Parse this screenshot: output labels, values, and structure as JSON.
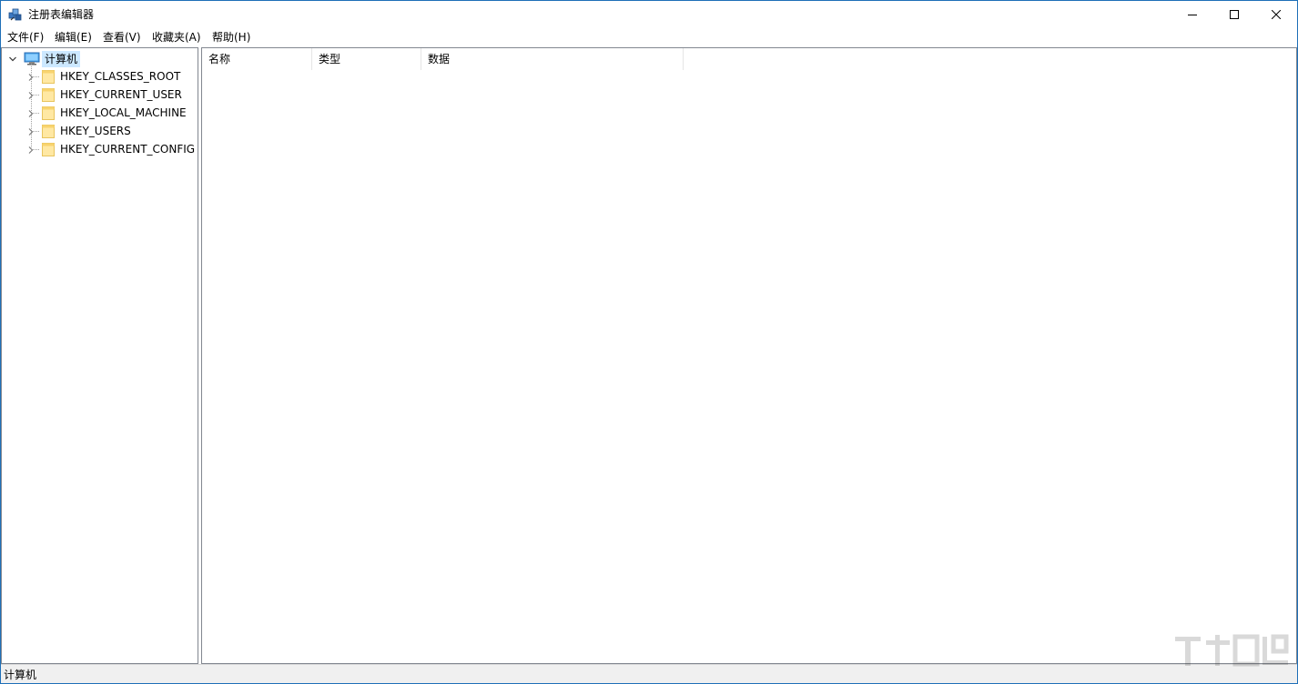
{
  "window": {
    "title": "注册表编辑器",
    "accent": "#1e6fb8"
  },
  "menu": [
    "文件(F)",
    "编辑(E)",
    "查看(V)",
    "收藏夹(A)",
    "帮助(H)"
  ],
  "tree": {
    "root": {
      "label": "计算机",
      "icon": "computer-icon",
      "expanded": true,
      "selected": true
    },
    "children": [
      {
        "label": "HKEY_CLASSES_ROOT",
        "icon": "folder-icon"
      },
      {
        "label": "HKEY_CURRENT_USER",
        "icon": "folder-icon"
      },
      {
        "label": "HKEY_LOCAL_MACHINE",
        "icon": "folder-icon"
      },
      {
        "label": "HKEY_USERS",
        "icon": "folder-icon"
      },
      {
        "label": "HKEY_CURRENT_CONFIG",
        "icon": "folder-icon"
      }
    ]
  },
  "list": {
    "columns": [
      "名称",
      "类型",
      "数据"
    ]
  },
  "status": {
    "path": "计算机"
  }
}
